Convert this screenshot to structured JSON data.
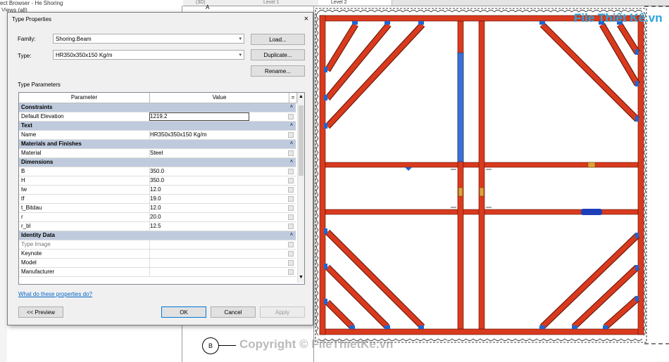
{
  "background": {
    "project_browser_title": "ect Browser - He Shoring",
    "views_label": "Views (all)",
    "tabs": [
      "(3D)",
      "Level 1",
      "Level 2"
    ],
    "grid_marker_a": "A",
    "grid_marker_b": "B"
  },
  "dialog": {
    "title": "Type Properties",
    "close_glyph": "×",
    "family_label": "Family:",
    "family_value": "Shoring.Beam",
    "type_label": "Type:",
    "type_value": "HR350x350x150 Kg/m",
    "load_button": "Load...",
    "duplicate_button": "Duplicate...",
    "rename_button": "Rename...",
    "type_parameters_label": "Type Parameters",
    "grid_headers": [
      "Parameter",
      "Value"
    ],
    "rows": [
      {
        "kind": "group",
        "label": "Constraints"
      },
      {
        "kind": "param",
        "label": "Default Elevation",
        "value": "1219.2",
        "editing": true
      },
      {
        "kind": "group",
        "label": "Text"
      },
      {
        "kind": "param",
        "label": "Name",
        "value": "HR350x350x150 Kg/m"
      },
      {
        "kind": "group",
        "label": "Materials and Finishes"
      },
      {
        "kind": "param",
        "label": "Material",
        "value": "Steel"
      },
      {
        "kind": "group",
        "label": "Dimensions"
      },
      {
        "kind": "param",
        "label": "B",
        "value": "350.0"
      },
      {
        "kind": "param",
        "label": "H",
        "value": "350.0"
      },
      {
        "kind": "param",
        "label": "tw",
        "value": "12.0"
      },
      {
        "kind": "param",
        "label": "tf",
        "value": "19.0"
      },
      {
        "kind": "param",
        "label": "t_Bitdau",
        "value": "12.0"
      },
      {
        "kind": "param",
        "label": "r",
        "value": "20.0"
      },
      {
        "kind": "param",
        "label": "r_bl",
        "value": "12.5"
      },
      {
        "kind": "group",
        "label": "Identity Data"
      },
      {
        "kind": "param",
        "label": "Type Image",
        "value": "",
        "inactive": true
      },
      {
        "kind": "param",
        "label": "Keynote",
        "value": ""
      },
      {
        "kind": "param",
        "label": "Model",
        "value": ""
      },
      {
        "kind": "param",
        "label": "Manufacturer",
        "value": ""
      }
    ],
    "help_link": "What do these properties do?",
    "preview_button": "<< Preview",
    "ok_button": "OK",
    "cancel_button": "Cancel",
    "apply_button": "Apply"
  },
  "watermark": {
    "logo_text": "File Thiết Kế.vn",
    "copyright": "Copyright © FileThietKe.vn"
  },
  "colors": {
    "beam": "#d93a1e",
    "beam_selected": "#3b6fd6",
    "connector": "#1e66d0",
    "group_row": "#bfcbdd"
  }
}
